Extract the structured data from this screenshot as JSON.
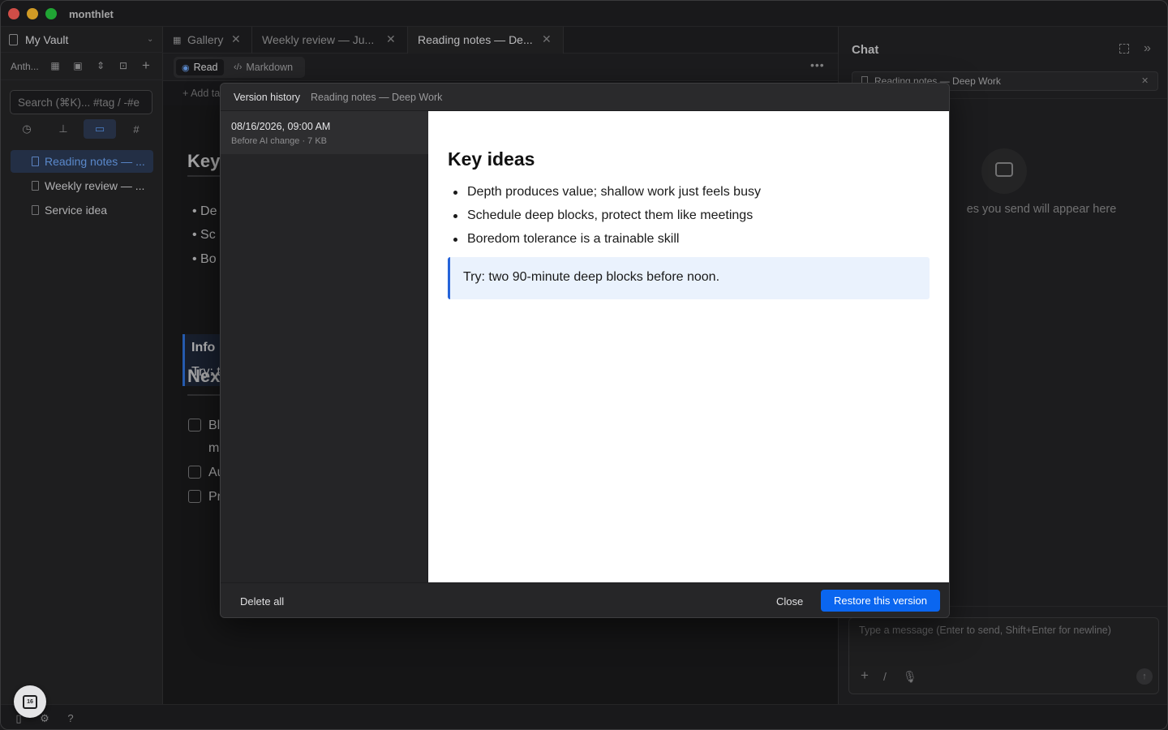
{
  "app": {
    "title": "monthlet"
  },
  "sidebar": {
    "vault_name": "My Vault",
    "toolbar_label": "Anth...",
    "search_placeholder": "Search (⌘K)... #tag / -#e",
    "files": [
      {
        "label": "Reading notes — ...",
        "active": true
      },
      {
        "label": "Weekly review — ...",
        "active": false
      },
      {
        "label": "Service idea",
        "active": false
      }
    ]
  },
  "tabs": [
    {
      "label": "Gallery",
      "icon": "grid-icon"
    },
    {
      "label": "Weekly review — Ju..."
    },
    {
      "label": "Reading notes — De...",
      "active": true
    }
  ],
  "editor": {
    "mode_read": "Read",
    "mode_markdown": "Markdown",
    "add_tag": "+ Add ta",
    "heading1": "Key",
    "bullets": [
      "De",
      "Sc",
      "Bo"
    ],
    "callout_title": "Info",
    "callout_text": "Try: t",
    "heading2": "Nex",
    "tasks": [
      "Bl",
      "m",
      "Au",
      "Pr"
    ]
  },
  "chat": {
    "title": "Chat",
    "context_chip": "Reading notes — Deep Work",
    "empty_text": "es you send will appear here",
    "input_placeholder": "Type a message (Enter to send, Shift+Enter for newline)"
  },
  "modal": {
    "title": "Version history",
    "subtitle": "Reading notes — Deep Work",
    "versions": [
      {
        "date": "08/16/2026, 09:00 AM",
        "meta": "Before AI change · 7 KB"
      }
    ],
    "preview": {
      "heading": "Key ideas",
      "bullets": [
        "Depth produces value; shallow work just feels busy",
        "Schedule deep blocks, protect them like meetings",
        "Boredom tolerance is a trainable skill"
      ],
      "callout": "Try: two 90-minute deep blocks before noon."
    },
    "delete_all": "Delete all",
    "close": "Close",
    "restore": "Restore this version"
  },
  "colors": {
    "accent": "#0a66f0",
    "active_file": "#2b3a55",
    "callout_bg": "#eaf2fd"
  }
}
